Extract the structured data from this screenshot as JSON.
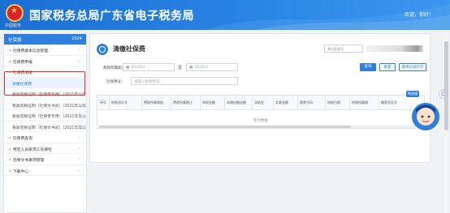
{
  "header": {
    "title": "国家税务总局广东省电子税务局",
    "logo_sub": "中国税务",
    "welcome": "欢迎，你好！",
    "colors": {
      "bar": "#2b86e6"
    }
  },
  "sidebar": {
    "head_title": "社保费",
    "head_year": "2024",
    "items": [
      {
        "label": "社保费基本信息管理",
        "type": "group"
      },
      {
        "label": "社保费申报",
        "type": "group"
      },
      {
        "label": "社保费清缴",
        "type": "group"
      },
      {
        "label": "清缴社保费",
        "type": "sub-active"
      },
      {
        "label": "税收完税证明（社保费专用）(2021年以前)",
        "type": "sub"
      },
      {
        "label": "税收完税证明（社保文书式）(2021年以前)",
        "type": "sub"
      },
      {
        "label": "税收完税证明（社保费专用）(2021年及以后)",
        "type": "sub"
      },
      {
        "label": "税收完税证明（社保文书式）(2021年及以后)",
        "type": "sub"
      },
      {
        "label": "社保费查询",
        "type": "group"
      },
      {
        "label": "特定人员单项工伤保险",
        "type": "group"
      },
      {
        "label": "社保文书事项管理",
        "type": "group"
      },
      {
        "label": "下载中心",
        "type": "group"
      }
    ]
  },
  "main": {
    "title": "清缴社保费",
    "tax_id_label": "单位社保号",
    "period_label": "费款所属期：",
    "date_from": "202403",
    "date_to": "202403",
    "date_sep": "至",
    "collect_label": "社保费号：",
    "collect_placeholder": "请输入税款所号",
    "buttons": {
      "query": "查询",
      "reset": "重置",
      "print": "缴清记录打印"
    },
    "columns": [
      "序号",
      "申报流水号",
      "费款所属期起",
      "费款所属期止",
      "申报金额",
      "本期应缴金额",
      "滞纳金",
      "实收金额",
      "税票号码",
      "申报日期",
      "申报所属期",
      "缴款凭证号"
    ],
    "empty_text": "暂无数据"
  },
  "widgets": {
    "float_icon": "person-circle-icon",
    "assistant_label": "粤税通",
    "assistant_icon": "assistant-avatar-icon"
  }
}
